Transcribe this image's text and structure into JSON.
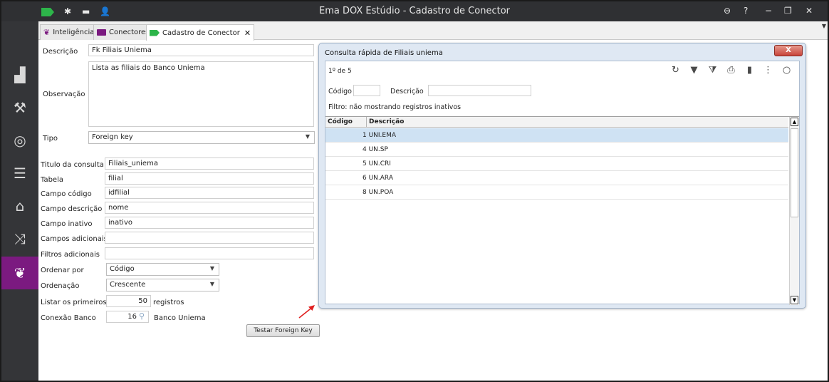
{
  "window": {
    "title": "Ema DOX Estúdio - Cadastro de Conector",
    "controls": [
      "⊖",
      "?",
      "−",
      "❐",
      "✕"
    ]
  },
  "tabs": [
    {
      "label": "Inteligência"
    },
    {
      "label": "Conectores"
    },
    {
      "label": "Cadastro de Conector",
      "close": "✕"
    }
  ],
  "form": {
    "descricao_label": "Descrição",
    "descricao_value": "Fk Filiais Uniema",
    "observacao_label": "Observação",
    "observacao_value": "Lista as filiais do Banco Uniema",
    "tipo_label": "Tipo",
    "tipo_value": "Foreign key",
    "titulo_label": "Titulo da consulta",
    "titulo_value": "Filiais_uniema",
    "tabela_label": "Tabela",
    "tabela_value": "filial",
    "campo_codigo_label": "Campo código",
    "campo_codigo_value": "idfilial",
    "campo_descricao_label": "Campo descrição",
    "campo_descricao_value": "nome",
    "campo_inativo_label": "Campo inativo",
    "campo_inativo_value": "inativo",
    "campos_adicionais_label": "Campos adicionais",
    "campos_adicionais_value": "",
    "filtros_adicionais_label": "Filtros adicionais",
    "filtros_adicionais_value": "",
    "ordenar_label": "Ordenar por",
    "ordenar_value": "Código",
    "ordenacao_label": "Ordenação",
    "ordenacao_value": "Crescente",
    "listar_label": "Listar os primeiros",
    "listar_value": "50",
    "listar_suffix": "registros",
    "conexao_label": "Conexão Banco",
    "conexao_value": "16",
    "conexao_name": "Banco Uniema",
    "test_button": "Testar Foreign Key"
  },
  "dialog": {
    "title": "Consulta rápida de Filiais uniema",
    "close_label": "X",
    "count": "1º de 5",
    "codigo_label": "Código",
    "descricao_label": "Descrição",
    "filter_text": "Filtro:  não mostrando registros inativos",
    "columns": [
      "Código",
      "Descrição"
    ],
    "rows": [
      {
        "codigo": "1",
        "descricao": "UNI.EMA"
      },
      {
        "codigo": "4",
        "descricao": "UN.SP"
      },
      {
        "codigo": "5",
        "descricao": "UN.CRI"
      },
      {
        "codigo": "6",
        "descricao": "UN.ARA"
      },
      {
        "codigo": "8",
        "descricao": "UN.POA"
      }
    ]
  },
  "colors": {
    "sidebar_bg": "#343538",
    "active_purple": "#7b1a80",
    "tag_green": "#2db54a",
    "selected_row": "#cfe2f3",
    "arrow_red": "#e02020"
  }
}
